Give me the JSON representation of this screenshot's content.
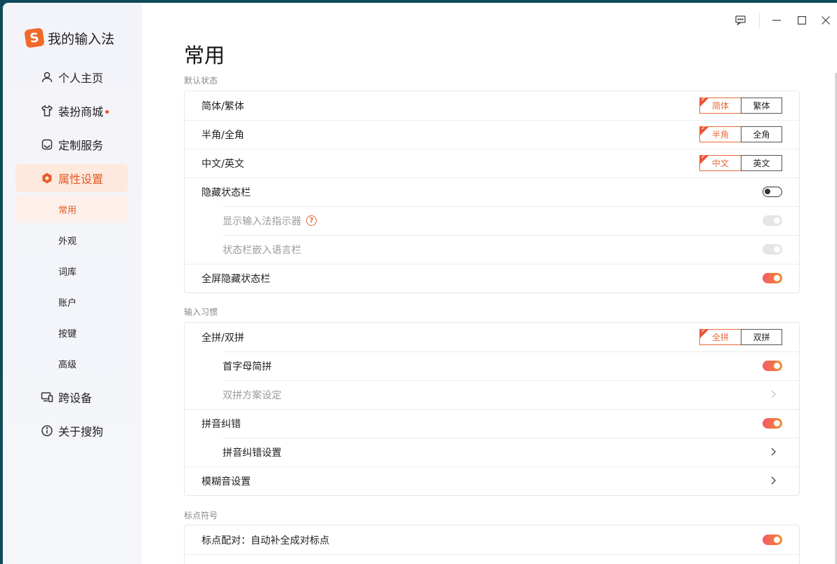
{
  "app": {
    "logo_letter": "S",
    "name": "我的输入法",
    "accent": "#f06a2b"
  },
  "sidebar": {
    "items": [
      {
        "label": "个人主页",
        "icon": "user-icon"
      },
      {
        "label": "装扮商城",
        "icon": "shirt-icon",
        "badge": true
      },
      {
        "label": "定制服务",
        "icon": "inbox-icon"
      },
      {
        "label": "属性设置",
        "icon": "hexagon-gear-icon",
        "active": true
      }
    ],
    "sub_items": [
      {
        "label": "常用",
        "active": true
      },
      {
        "label": "外观"
      },
      {
        "label": "词库"
      },
      {
        "label": "账户"
      },
      {
        "label": "按键"
      },
      {
        "label": "高级"
      }
    ],
    "bottom_items": [
      {
        "label": "跨设备",
        "icon": "devices-icon"
      },
      {
        "label": "关于搜狗",
        "icon": "info-icon"
      }
    ]
  },
  "main": {
    "title": "常用",
    "sections": [
      {
        "label": "默认状态",
        "rows": [
          {
            "label": "简体/繁体",
            "control": "segment",
            "options": [
              "简体",
              "繁体"
            ],
            "selected": 0
          },
          {
            "label": "半角/全角",
            "control": "segment",
            "options": [
              "半角",
              "全角"
            ],
            "selected": 0
          },
          {
            "label": "中文/英文",
            "control": "segment",
            "options": [
              "中文",
              "英文"
            ],
            "selected": 0
          },
          {
            "label": "隐藏状态栏",
            "control": "toggle",
            "state": "off"
          },
          {
            "label": "显示输入法指示器",
            "control": "toggle",
            "state": "disabled",
            "indent": true,
            "help": "?"
          },
          {
            "label": "状态栏嵌入语言栏",
            "control": "toggle",
            "state": "disabled",
            "indent": true
          },
          {
            "label": "全屏隐藏状态栏",
            "control": "toggle",
            "state": "on"
          }
        ]
      },
      {
        "label": "输入习惯",
        "rows": [
          {
            "label": "全拼/双拼",
            "control": "segment",
            "options": [
              "全拼",
              "双拼"
            ],
            "selected": 0
          },
          {
            "label": "首字母简拼",
            "control": "toggle",
            "state": "on",
            "indent": true
          },
          {
            "label": "双拼方案设定",
            "control": "chevron",
            "indent": true,
            "disabled": true
          },
          {
            "label": "拼音纠错",
            "control": "toggle",
            "state": "on"
          },
          {
            "label": "拼音纠错设置",
            "control": "chevron",
            "indent": true
          },
          {
            "label": "模糊音设置",
            "control": "chevron"
          }
        ]
      },
      {
        "label": "标点符号",
        "rows": [
          {
            "label": "标点配对：自动补全成对标点",
            "control": "toggle",
            "state": "on"
          }
        ]
      }
    ]
  }
}
